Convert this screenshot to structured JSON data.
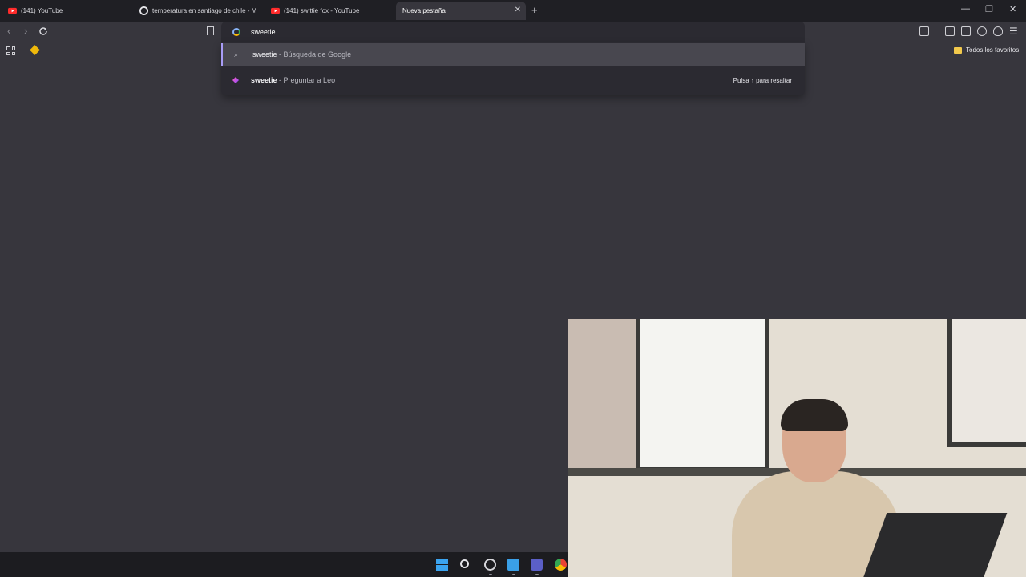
{
  "browser": {
    "tabs": [
      {
        "title": "(141) YouTube",
        "icon": "youtube-icon",
        "active": false
      },
      {
        "title": "temperatura en santiago de chile - M",
        "icon": "google-icon",
        "active": false
      },
      {
        "title": "(141) swittie fox - YouTube",
        "icon": "youtube-icon",
        "active": false
      },
      {
        "title": "Nueva pestaña",
        "icon": "",
        "active": true
      }
    ],
    "new_tab_symbol": "+",
    "close_symbol": "✕",
    "window_controls": {
      "minimize": "—",
      "restore": "❐",
      "close": "✕"
    }
  },
  "address_bar": {
    "value": "sweetie",
    "engine_icon": "google-icon"
  },
  "bookmarks_bar": {
    "all_favorites_label": "Todos los favoritos"
  },
  "suggestions": [
    {
      "term": "sweetie",
      "sub": " - Búsqueda de Google",
      "icon": "search-icon",
      "hint": ""
    },
    {
      "term": "sweetie",
      "sub": " - Preguntar a Leo",
      "icon": "leo-icon",
      "hint": "Pulsa ↑ para resaltar"
    }
  ],
  "colors": {
    "background": "#37363d",
    "tabstrip": "#1f1f24",
    "accent": "#a89cf7"
  }
}
